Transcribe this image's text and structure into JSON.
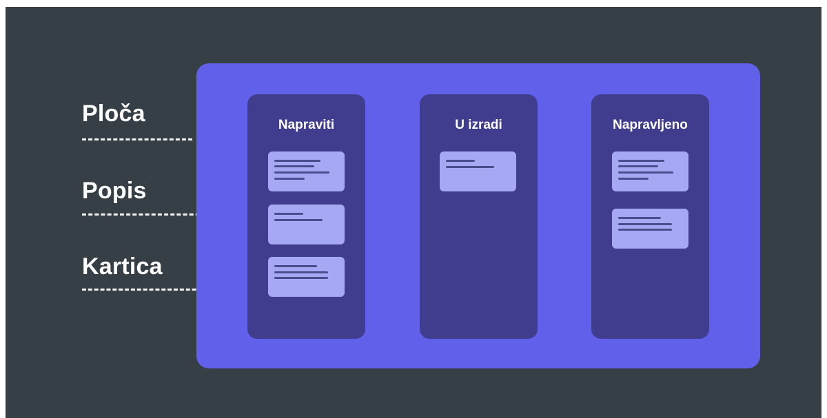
{
  "labels": {
    "board": "Ploča",
    "list": "Popis",
    "card": "Kartica"
  },
  "lists": [
    {
      "title": "Napraviti",
      "cards": 3
    },
    {
      "title": "U izradi",
      "cards": 1
    },
    {
      "title": "Napravljeno",
      "cards": 2
    }
  ],
  "colors": {
    "background": "#353f45",
    "board": "#6060ea",
    "list": "#403d8f",
    "card": "#a7a8f3",
    "card_line": "#4a4c8c",
    "text": "#ffffff"
  }
}
